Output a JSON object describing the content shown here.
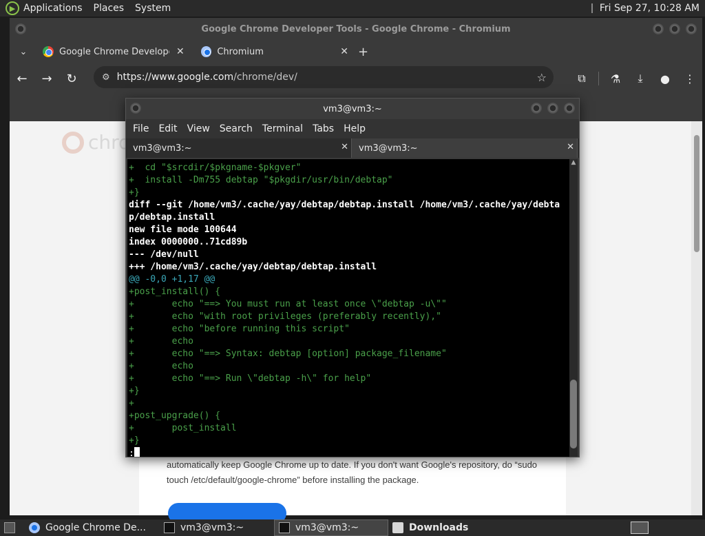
{
  "top_panel": {
    "menus": [
      "Applications",
      "Places",
      "System"
    ],
    "clock": "Fri Sep 27, 10:28 AM"
  },
  "chrome": {
    "window_title": "Google Chrome Developer Tools - Google Chrome - Chromium",
    "tabs": [
      {
        "title": "Google Chrome Developer T",
        "close": "✕"
      },
      {
        "title": "Chromium",
        "close": "✕"
      }
    ],
    "new_tab": "+",
    "tab_menu": "⌄",
    "url_host": "https://www.google.com",
    "url_path": "/chrome/dev/",
    "page_text": "automatically keep Google Chrome up to date. If you don't want Google's repository, do “sudo touch /etc/default/google-chrome” before installing the package.",
    "faded_logo_text": "chro"
  },
  "terminal": {
    "title": "vm3@vm3:~",
    "menu": [
      "File",
      "Edit",
      "View",
      "Search",
      "Terminal",
      "Tabs",
      "Help"
    ],
    "tabs": [
      {
        "title": "vm3@vm3:~",
        "close": "✕"
      },
      {
        "title": "vm3@vm3:~",
        "close": "✕"
      }
    ],
    "lines": [
      {
        "text": "+  cd \"$srcdir/$pkgname-$pkgver\"",
        "style": "green"
      },
      {
        "text": "+  install -Dm755 debtap \"$pkgdir/usr/bin/debtap\"",
        "style": "green"
      },
      {
        "text": "+}",
        "style": "green"
      },
      {
        "text": "diff --git /home/vm3/.cache/yay/debtap/debtap.install /home/vm3/.cache/yay/debta",
        "style": "white-bold"
      },
      {
        "text": "p/debtap.install",
        "style": "white-bold"
      },
      {
        "text": "new file mode 100644",
        "style": "white-bold"
      },
      {
        "text": "index 0000000..71cd89b",
        "style": "white-bold"
      },
      {
        "text": "--- /dev/null",
        "style": "white-bold"
      },
      {
        "text": "+++ /home/vm3/.cache/yay/debtap/debtap.install",
        "style": "white-bold"
      },
      {
        "text": "@@ -0,0 +1,17 @@",
        "style": "cyan"
      },
      {
        "text": "+post_install() {",
        "style": "green"
      },
      {
        "text": "+       echo \"==> You must run at least once \\\"debtap -u\\\"\"",
        "style": "green"
      },
      {
        "text": "+       echo \"with root privileges (preferably recently),\"",
        "style": "green"
      },
      {
        "text": "+       echo \"before running this script\"",
        "style": "green"
      },
      {
        "text": "+       echo",
        "style": "green"
      },
      {
        "text": "+       echo \"==> Syntax: debtap [option] package_filename\"",
        "style": "green"
      },
      {
        "text": "+       echo",
        "style": "green"
      },
      {
        "text": "+       echo \"==> Run \\\"debtap -h\\\" for help\"",
        "style": "green"
      },
      {
        "text": "+}",
        "style": "green"
      },
      {
        "text": "+",
        "style": "green"
      },
      {
        "text": "+post_upgrade() {",
        "style": "green"
      },
      {
        "text": "+       post_install",
        "style": "green"
      },
      {
        "text": "+}",
        "style": "green"
      }
    ],
    "prompt": ":"
  },
  "taskbar": {
    "items": [
      {
        "label": "Google Chrome De..."
      },
      {
        "label": "vm3@vm3:~"
      },
      {
        "label": "vm3@vm3:~"
      },
      {
        "label": "Downloads"
      }
    ]
  }
}
